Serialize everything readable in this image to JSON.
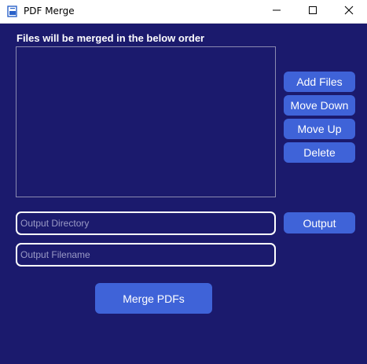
{
  "window": {
    "title": "PDF Merge",
    "icon": "pdf-app-icon",
    "controls": [
      "minimize-icon",
      "maximize-icon",
      "close-icon"
    ]
  },
  "files": {
    "label": "Files will be merged in the below order",
    "items": []
  },
  "buttons": {
    "add_files": "Add Files",
    "move_down": "Move Down",
    "move_up": "Move Up",
    "delete": "Delete",
    "output": "Output",
    "merge": "Merge PDFs"
  },
  "fields": {
    "output_directory": {
      "value": "",
      "placeholder": "Output Directory"
    },
    "output_filename": {
      "value": "",
      "placeholder": "Output Filename"
    }
  },
  "colors": {
    "background": "#1b1a6d",
    "button": "#3f63d8",
    "field_border": "#ffffff",
    "placeholder": "#9a9ac6"
  }
}
